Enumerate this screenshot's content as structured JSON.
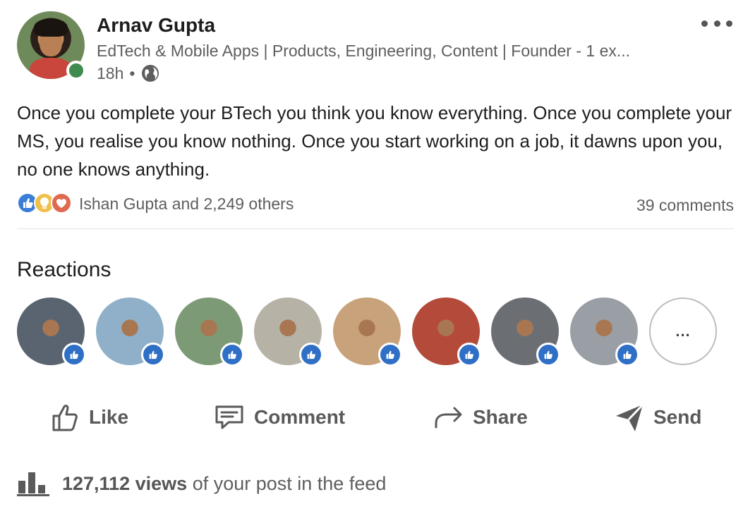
{
  "author": {
    "name": "Arnav Gupta",
    "headline": "EdTech & Mobile Apps | Products, Engineering, Content | Founder - 1 ex...",
    "time": "18h",
    "separator": "•"
  },
  "post": {
    "text": "Once you complete your BTech you think you know everything. Once you complete your MS, you realise you know nothing. Once you start working on a job, it dawns upon you, no one knows anything."
  },
  "social": {
    "reactors": "Ishan Gupta and 2,249 others",
    "comments": "39 comments",
    "reaction_icons": [
      "like-icon",
      "insightful-icon",
      "love-icon"
    ]
  },
  "reactions": {
    "title": "Reactions",
    "more_label": "...",
    "avatars": [
      {
        "bg": "#5a6470"
      },
      {
        "bg": "#8fb0c8"
      },
      {
        "bg": "#7d9a76"
      },
      {
        "bg": "#b7b2a6"
      },
      {
        "bg": "#c8a27a"
      },
      {
        "bg": "#b34a3a"
      },
      {
        "bg": "#6b6f74"
      },
      {
        "bg": "#9a9fa6"
      }
    ]
  },
  "actions": {
    "like": "Like",
    "comment": "Comment",
    "share": "Share",
    "send": "Send"
  },
  "analytics": {
    "views": "127,112 views",
    "suffix": "of your post in the feed"
  },
  "colors": {
    "accent": "#2f6fc5",
    "online": "#3f8a4e",
    "muted_text": "#5e5e5e"
  }
}
